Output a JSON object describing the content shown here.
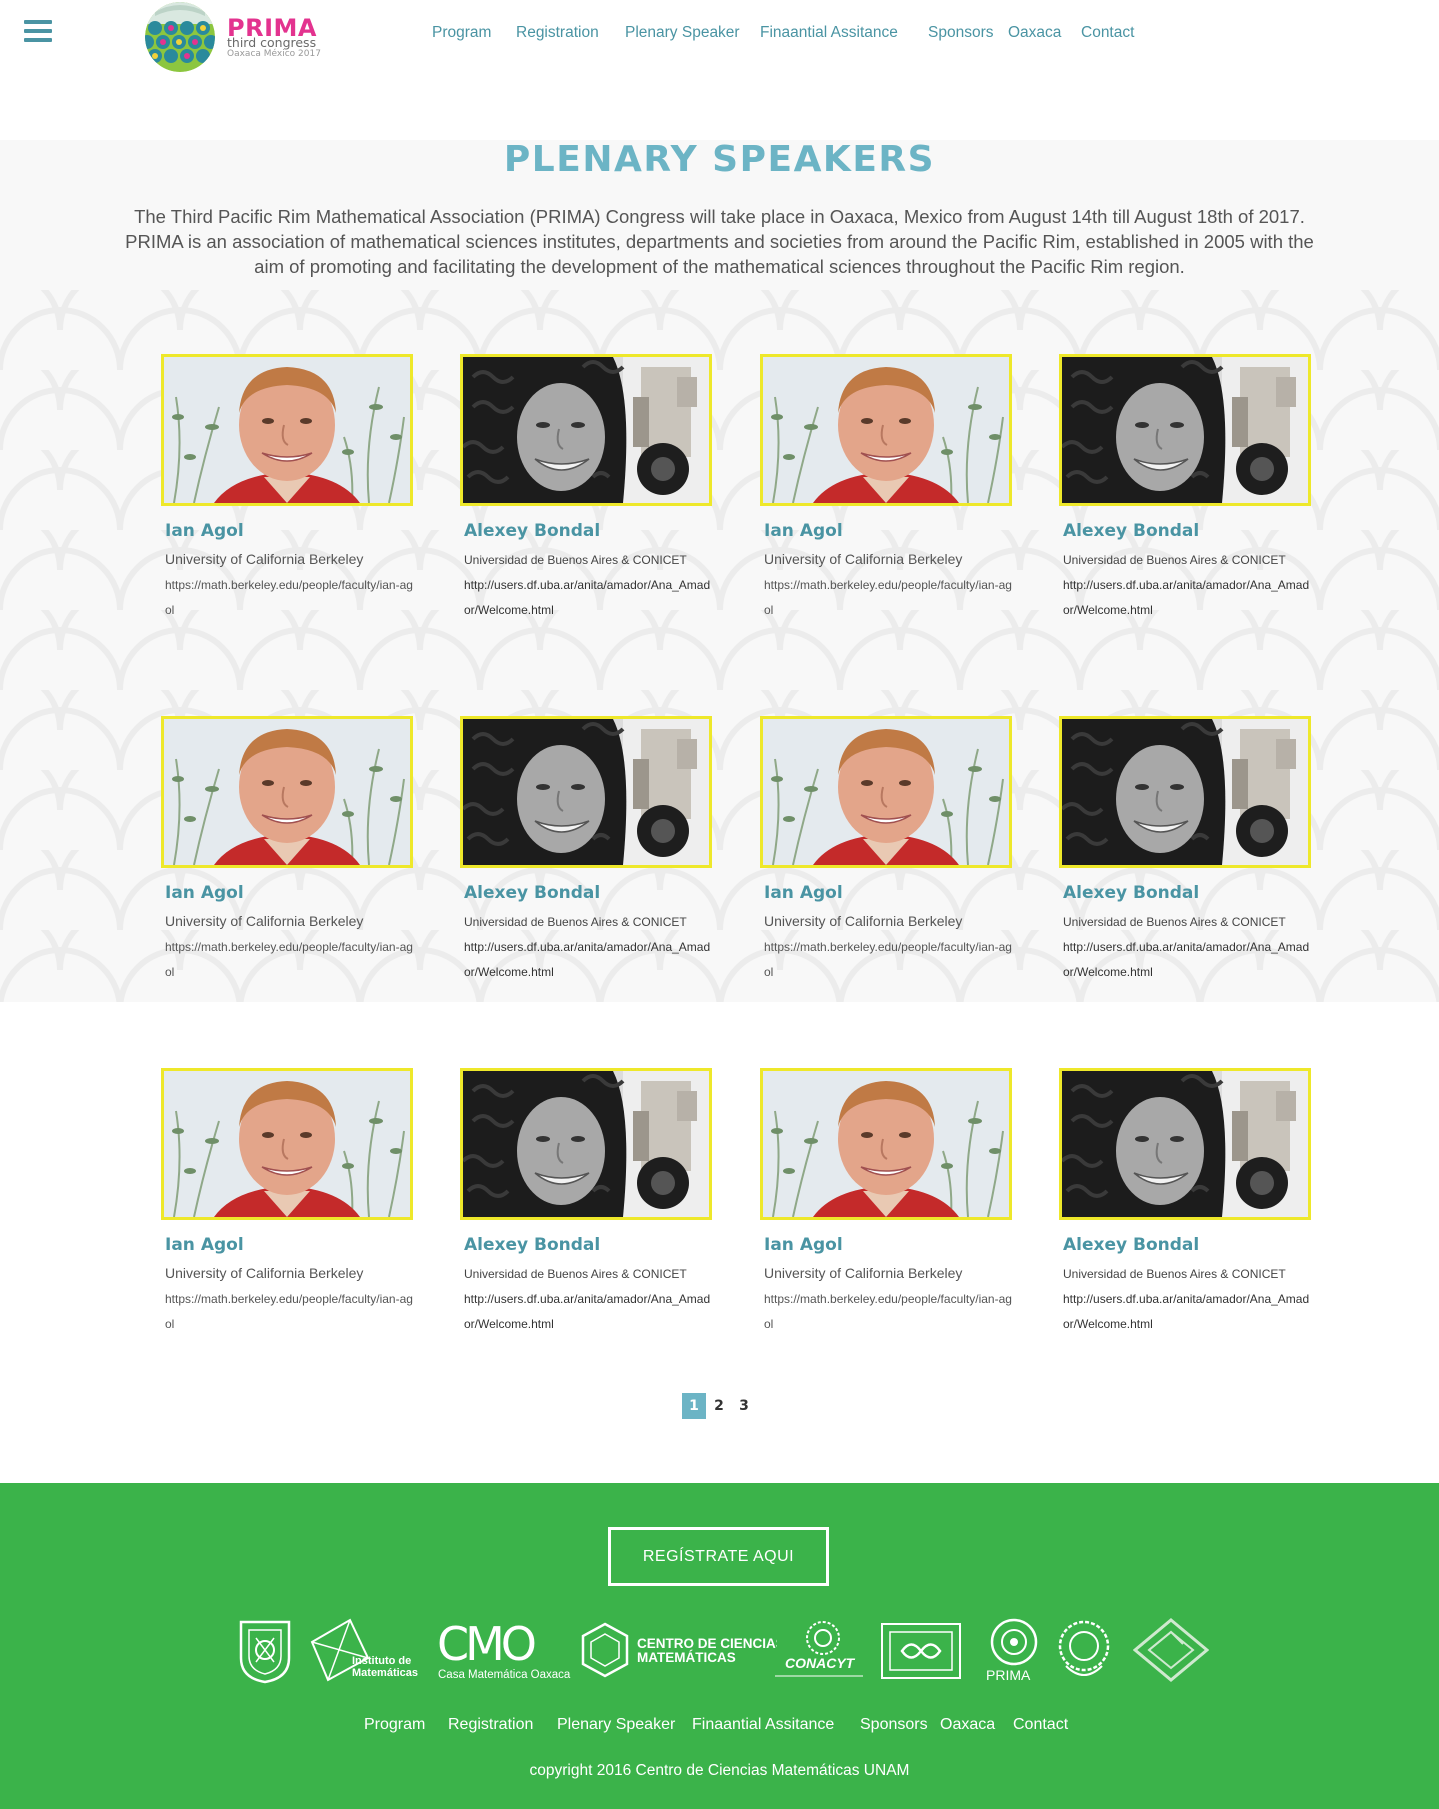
{
  "brand": {
    "title": "PRIMA",
    "subtitle": "third congress",
    "tagline": "Oaxaca México 2017",
    "accent": "#e3338f",
    "primary": "#4a94a3",
    "heading": "#6cb4c5",
    "photo_border": "#eee82a",
    "footer_bg": "#3bb34a"
  },
  "header": {
    "menu_icon": "hamburger-menu-icon",
    "nav": [
      "Program",
      "Registration",
      "Plenary Speaker",
      "Finaantial Assitance",
      "Sponsors",
      "Oaxaca",
      "Contact"
    ]
  },
  "main": {
    "title": "PLENARY SPEAKERS",
    "intro": "The Third Pacific Rim Mathematical Association (PRIMA) Congress will take place in Oaxaca, Mexico from August 14th till August 18th of 2017. PRIMA is an association of mathematical sciences institutes, departments and societies from around the Pacific Rim, established in 2005 with the aim of promoting and facilitating the development of the mathematical sciences throughout the Pacific Rim region."
  },
  "speakers": [
    {
      "name": "Ian Agol",
      "affiliation": "University of California Berkeley",
      "url": "https://math.berkeley.edu/people/faculty/ian-agol"
    },
    {
      "name": "Alexey Bondal",
      "affiliation": "Universidad de Buenos Aires & CONICET",
      "url": "http://users.df.uba.ar/anita/amador/Ana_Amador/Welcome.html"
    },
    {
      "name": "Ian Agol",
      "affiliation": "University of California Berkeley",
      "url": "https://math.berkeley.edu/people/faculty/ian-agol"
    },
    {
      "name": "Alexey Bondal",
      "affiliation": "Universidad de Buenos Aires & CONICET",
      "url": "http://users.df.uba.ar/anita/amador/Ana_Amador/Welcome.html"
    },
    {
      "name": "Ian Agol",
      "affiliation": "University of California Berkeley",
      "url": "https://math.berkeley.edu/people/faculty/ian-agol"
    },
    {
      "name": "Alexey Bondal",
      "affiliation": "Universidad de Buenos Aires & CONICET",
      "url": "http://users.df.uba.ar/anita/amador/Ana_Amador/Welcome.html"
    },
    {
      "name": "Ian Agol",
      "affiliation": "University of California Berkeley",
      "url": "https://math.berkeley.edu/people/faculty/ian-agol"
    },
    {
      "name": "Alexey Bondal",
      "affiliation": "Universidad de Buenos Aires & CONICET",
      "url": "http://users.df.uba.ar/anita/amador/Ana_Amador/Welcome.html"
    },
    {
      "name": "Ian Agol",
      "affiliation": "University of California Berkeley",
      "url": "https://math.berkeley.edu/people/faculty/ian-agol"
    },
    {
      "name": "Alexey Bondal",
      "affiliation": "Universidad de Buenos Aires & CONICET",
      "url": "http://users.df.uba.ar/anita/amador/Ana_Amador/Welcome.html"
    },
    {
      "name": "Ian Agol",
      "affiliation": "University of California Berkeley",
      "url": "https://math.berkeley.edu/people/faculty/ian-agol"
    },
    {
      "name": "Alexey Bondal",
      "affiliation": "Universidad de Buenos Aires & CONICET",
      "url": "http://users.df.uba.ar/anita/amador/Ana_Amador/Welcome.html"
    }
  ],
  "pagination": {
    "pages": [
      "1",
      "2",
      "3"
    ],
    "current": "1"
  },
  "footer": {
    "register_label": "REGÍSTRATE AQUI",
    "sponsors": [
      {
        "icon": "unam-crest-icon"
      },
      {
        "icon": "instituto-matematicas-logo",
        "line1": "Instituto de",
        "line2": "Matemáticas"
      },
      {
        "icon": "cmo-logo",
        "mark": "CMO",
        "caption": "Casa Matemática Oaxaca"
      },
      {
        "icon": "centro-ciencias-matematicas-logo",
        "line1": "CENTRO DE CIENCIAS",
        "line2": "MATEMÁTICAS"
      },
      {
        "icon": "conacyt-logo",
        "mark": "CONACYT"
      },
      {
        "icon": "academia-mexicana-ciencias-logo"
      },
      {
        "icon": "prima-logo",
        "mark": "PRIMA"
      },
      {
        "icon": "university-seal-icon"
      },
      {
        "icon": "diamond-logo-icon"
      }
    ],
    "nav": [
      "Program",
      "Registration",
      "Plenary Speaker",
      "Finaantial Assitance",
      "Sponsors",
      "Oaxaca",
      "Contact"
    ],
    "copyright": "copyright 2016 Centro de Ciencias Matemáticas UNAM"
  }
}
